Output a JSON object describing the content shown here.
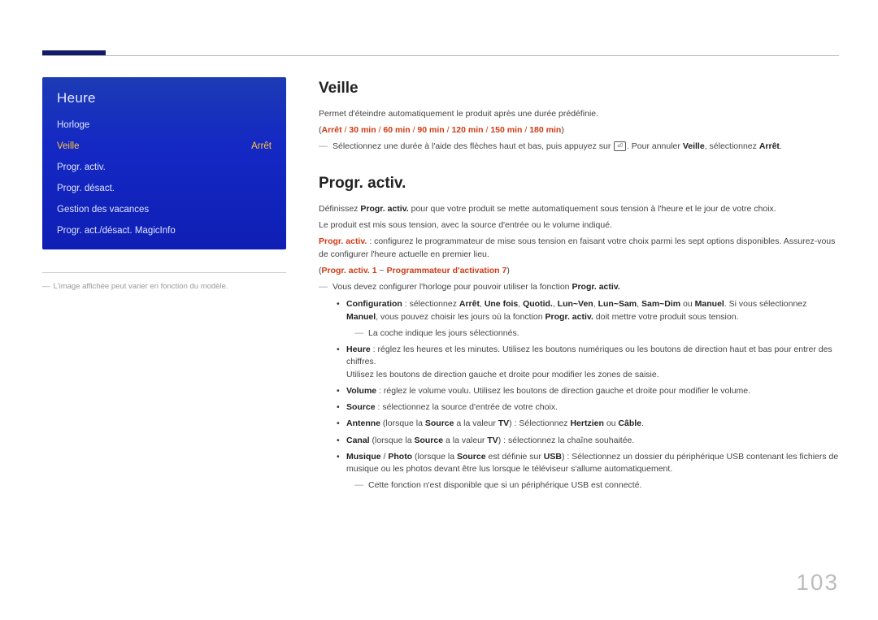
{
  "page_number": "103",
  "sidebar": {
    "menu_title": "Heure",
    "items": [
      {
        "label": "Horloge",
        "value": ""
      },
      {
        "label": "Veille",
        "value": "Arrêt"
      },
      {
        "label": "Progr. activ.",
        "value": ""
      },
      {
        "label": "Progr. désact.",
        "value": ""
      },
      {
        "label": "Gestion des vacances",
        "value": ""
      },
      {
        "label": "Progr. act./désact. MagicInfo",
        "value": ""
      }
    ],
    "note": "L'image affichée peut varier en fonction du modèle."
  },
  "veille": {
    "heading": "Veille",
    "intro": "Permet d'éteindre automatiquement le produit après une durée prédéfinie.",
    "options": {
      "arret": "Arrêt",
      "s": " / ",
      "o30": "30 min",
      "o60": "60 min",
      "o90": "90 min",
      "o120": "120 min",
      "o150": "150 min",
      "o180": "180 min"
    },
    "tick_pre": "Sélectionnez une durée à l'aide des flèches haut et bas, puis appuyez sur ",
    "tick_post": ". Pour annuler ",
    "tick_veille": "Veille",
    "tick_sel": ", sélectionnez ",
    "tick_arret": "Arrêt",
    "tick_end": "."
  },
  "progr": {
    "heading": "Progr. activ.",
    "p1_pre": "Définissez ",
    "p1_bold": "Progr. activ.",
    "p1_post": " pour que votre produit se mette automatiquement sous tension à l'heure et le jour de votre choix.",
    "p2": "Le produit est mis sous tension, avec la source d'entrée ou le volume indiqué.",
    "p3_bold": "Progr. activ.",
    "p3_post": " : configurez le programmateur de mise sous tension en faisant votre choix parmi les sept options disponibles. Assurez-vous de configurer l'heure actuelle en premier lieu.",
    "opts_a": "Progr. activ. 1",
    "opts_sep": " ~ ",
    "opts_b": "Programmateur d'activation 7",
    "tick1_pre": "Vous devez configurer l'horloge pour pouvoir utiliser la fonction ",
    "tick1_bold": "Progr. activ.",
    "tick1_end": "",
    "bullets": {
      "config_label": "Configuration",
      "config_pre": " : sélectionnez ",
      "config_arret": "Arrêt",
      "config_c": ", ",
      "config_une": "Une fois",
      "config_quot": "Quotid.",
      "config_lv": "Lun~Ven",
      "config_ls": "Lun~Sam",
      "config_sd": "Sam~Dim",
      "config_ou": " ou ",
      "config_man": "Manuel",
      "config_post1": ". Si vous sélectionnez ",
      "config_man2": "Manuel",
      "config_post2": ", vous pouvez choisir les jours où la fonction ",
      "config_pa": "Progr. activ.",
      "config_post3": " doit mettre votre produit sous tension.",
      "config_sub": "La coche indique les jours sélectionnés.",
      "heure_label": "Heure",
      "heure_l1": " : réglez les heures et les minutes. Utilisez les boutons numériques ou les boutons de direction haut et bas pour entrer des chiffres.",
      "heure_l2": "Utilisez les boutons de direction gauche et droite pour modifier les zones de saisie.",
      "volume_label": "Volume",
      "volume_txt": " : réglez le volume voulu. Utilisez les boutons de direction gauche et droite pour modifier le volume.",
      "source_label": "Source",
      "source_txt": " : sélectionnez la source d'entrée de votre choix.",
      "antenne_label": "Antenne",
      "antenne_pre": " (lorsque la ",
      "antenne_src": "Source",
      "antenne_mid": " a la valeur ",
      "antenne_tv": "TV",
      "antenne_post": ") : Sélectionnez ",
      "antenne_h": "Hertzien",
      "antenne_ou": " ou ",
      "antenne_c": "Câble",
      "antenne_end": ".",
      "canal_label": "Canal",
      "canal_pre": " (lorsque la ",
      "canal_src": "Source",
      "canal_mid": " a la valeur ",
      "canal_tv": "TV",
      "canal_post": ") : sélectionnez la chaîne souhaitée.",
      "mp_m": "Musique",
      "mp_sep": " / ",
      "mp_p": "Photo",
      "mp_pre": " (lorsque la ",
      "mp_src": "Source",
      "mp_mid": " est définie sur ",
      "mp_usb": "USB",
      "mp_post": ") : Sélectionnez un dossier du périphérique USB contenant les fichiers de musique ou les photos devant être lus lorsque le téléviseur s'allume automatiquement.",
      "mp_sub": "Cette fonction n'est disponible que si un périphérique USB est connecté."
    }
  }
}
